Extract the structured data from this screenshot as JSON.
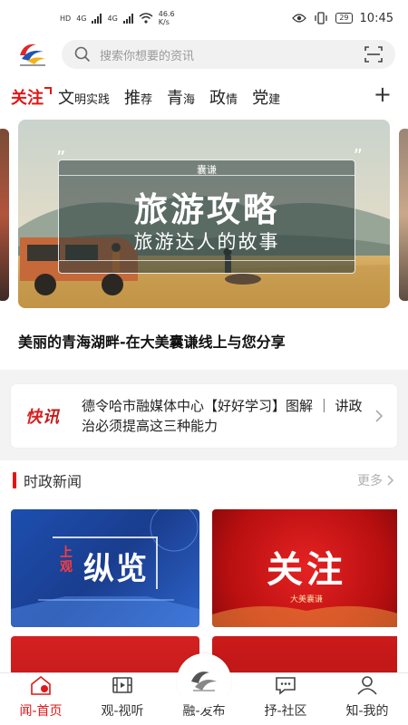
{
  "status_bar": {
    "network_left": "HD",
    "net_type_1": "4G",
    "net_type_2": "4G",
    "speed": "46.6",
    "speed_unit": "K/s",
    "battery": "29",
    "time": "10:45"
  },
  "search": {
    "placeholder": "搜索你想要的资讯"
  },
  "tabs": [
    {
      "big": "关注",
      "small": "",
      "active": true
    },
    {
      "big": "文",
      "small": "明实践"
    },
    {
      "big": "推",
      "small": "荐"
    },
    {
      "big": "青",
      "small": "海"
    },
    {
      "big": "政",
      "small": "情"
    },
    {
      "big": "党",
      "small": "建"
    }
  ],
  "banner": {
    "tag": "囊谦",
    "title": "旅游攻略",
    "subtitle": "旅游达人的故事"
  },
  "headline": "美丽的青海湖畔-在大美囊谦线上与您分享",
  "flash": {
    "label_big": "快",
    "label_small": "讯",
    "text": "德令哈市融媒体中心【好好学习】图解 ｜ 讲政治必须提高这三种能力"
  },
  "section": {
    "title": "时政新闻",
    "more": "更多"
  },
  "news_cards": [
    {
      "title": "纵览",
      "badge": "上观"
    },
    {
      "title": "关注",
      "sub": "大美囊谦"
    }
  ],
  "bottom_nav": [
    {
      "label": "闻-首页",
      "active": true,
      "icon": "home-icon"
    },
    {
      "label": "观-视听",
      "active": false,
      "icon": "film-icon"
    },
    {
      "label": "融-发布",
      "active": false,
      "icon": "publish-logo-icon"
    },
    {
      "label": "抒-社区",
      "active": false,
      "icon": "chat-icon"
    },
    {
      "label": "知-我的",
      "active": false,
      "icon": "user-icon"
    }
  ],
  "colors": {
    "accent": "#e01717",
    "search_bg": "#f1f1f1",
    "band_bg": "#f3f3f3"
  }
}
